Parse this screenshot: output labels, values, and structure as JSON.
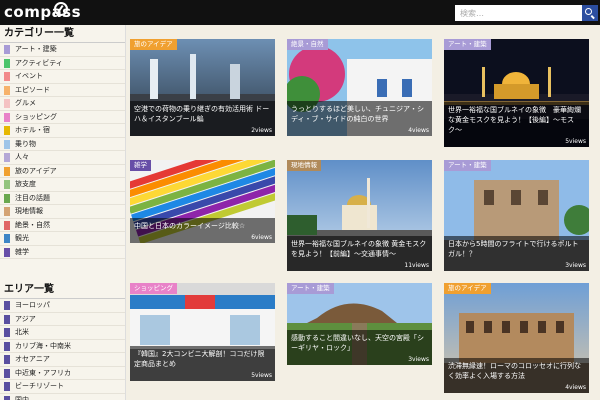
{
  "header": {
    "logo": "compass",
    "search_placeholder": "検索…"
  },
  "sidebar": {
    "categories_title": "カテゴリー一覧",
    "categories": [
      {
        "label": "アート・建築",
        "color": "#a89bd6"
      },
      {
        "label": "アクティビティ",
        "color": "#4dc46b"
      },
      {
        "label": "イベント",
        "color": "#f28a8a"
      },
      {
        "label": "エピソード",
        "color": "#f6b26b"
      },
      {
        "label": "グルメ",
        "color": "#f4c2c2"
      },
      {
        "label": "ショッピング",
        "color": "#e882c8"
      },
      {
        "label": "ホテル・宿",
        "color": "#e6b800"
      },
      {
        "label": "乗り物",
        "color": "#9fc5e8"
      },
      {
        "label": "人々",
        "color": "#b4a7d6"
      },
      {
        "label": "旅のアイデア",
        "color": "#f0a030"
      },
      {
        "label": "旅支度",
        "color": "#93c47d"
      },
      {
        "label": "注目の話題",
        "color": "#6aa84f"
      },
      {
        "label": "現地情報",
        "color": "#d4a373"
      },
      {
        "label": "絶景・自然",
        "color": "#e06666"
      },
      {
        "label": "観光",
        "color": "#3d85c6"
      },
      {
        "label": "雑学",
        "color": "#674ea7"
      }
    ],
    "areas_title": "エリア一覧",
    "areas": [
      {
        "label": "ヨーロッパ",
        "color": "#5a4fa0"
      },
      {
        "label": "アジア",
        "color": "#5a4fa0"
      },
      {
        "label": "北米",
        "color": "#5a4fa0"
      },
      {
        "label": "カリブ海・中南米",
        "color": "#5a4fa0"
      },
      {
        "label": "オセアニア",
        "color": "#5a4fa0"
      },
      {
        "label": "中近東・アフリカ",
        "color": "#5a4fa0"
      },
      {
        "label": "ビーチリゾート",
        "color": "#5a4fa0"
      },
      {
        "label": "国内",
        "color": "#5a4fa0"
      }
    ]
  },
  "cards": [
    {
      "tag": "旅のアイデア",
      "tag_color": "#f0a030",
      "title": "空港での荷物の乗り継ぎの有効活用術 ドーハ＆イスタンブール編",
      "views": "2views"
    },
    {
      "tag": "絶景・自然",
      "tag_color": "#a89bd6",
      "title": "うっとりするほど美しい、チュニジア・シディ・ブ・サイドの純白の世界",
      "views": "4views"
    },
    {
      "tag": "アート・建築",
      "tag_color": "#a89bd6",
      "title": "世界一裕福な国ブルネイの象徴　豪華絢爛な黄金モスクを見よう！【後編】〜モスク〜",
      "views": "5views"
    },
    {
      "tag": "雑学",
      "tag_color": "#674ea7",
      "title": "中国と日本のカラーイメージ比較☆",
      "views": "6views"
    },
    {
      "tag": "現地情報",
      "tag_color": "#b08a5a",
      "title": "世界一裕福な国ブルネイの象徴 黄金モスクを見よう！【前編】〜交通事情〜",
      "views": "11views"
    },
    {
      "tag": "アート・建築",
      "tag_color": "#a89bd6",
      "title": "日本から5時間のフライトで行けるポルトガル！？",
      "views": "3views"
    },
    {
      "tag": "ショッピング",
      "tag_color": "#e882c8",
      "title": "『韓国』2大コンビニ大解剖！ココだけ限定商品まとめ",
      "views": "5views"
    },
    {
      "tag": "アート・建築",
      "tag_color": "#a89bd6",
      "title": "感動すること間違いなし、天空の宮殿「シーギリヤ・ロック」",
      "views": "3views"
    },
    {
      "tag": "旅のアイデア",
      "tag_color": "#f0a030",
      "title": "渋滞無縁速！ローマのコロッセオに行列なく効率よく入場する方法",
      "views": "4views"
    }
  ]
}
